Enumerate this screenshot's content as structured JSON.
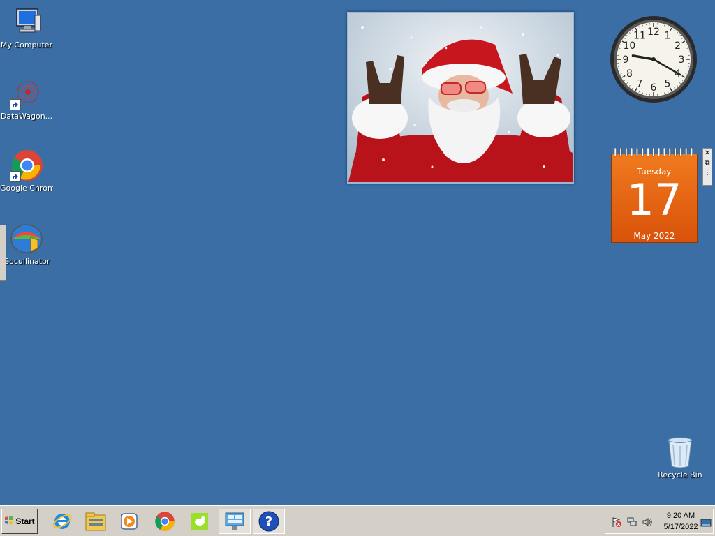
{
  "desktop": {
    "background_color": "#3a6ea5",
    "icons": [
      {
        "label": "My Computer",
        "icon": "computer-icon"
      },
      {
        "label": "DataWagon...",
        "icon": "datawagon-icon"
      },
      {
        "label": "Google Chrome",
        "icon": "chrome-icon"
      },
      {
        "label": "Gocullinator",
        "icon": "gocullinator-icon"
      },
      {
        "label": "Recycle Bin",
        "icon": "recycle-bin-icon"
      }
    ]
  },
  "gadgets": {
    "slideshow": {
      "subject": "santa-photo"
    },
    "clock": {
      "numerals": [
        "12",
        "1",
        "2",
        "3",
        "4",
        "5",
        "6",
        "7",
        "8",
        "9",
        "10",
        "11"
      ],
      "time": "9:20"
    },
    "calendar": {
      "weekday": "Tuesday",
      "day": "17",
      "month_year": "May 2022",
      "accent": "#e8650f"
    },
    "controls": {
      "close": "close-icon",
      "options": "options-icon",
      "drag": "drag-handle-icon"
    }
  },
  "taskbar": {
    "start_label": "Start",
    "pinned": [
      {
        "name": "internet-explorer-icon"
      },
      {
        "name": "file-explorer-icon"
      },
      {
        "name": "media-player-icon"
      },
      {
        "name": "chrome-icon"
      },
      {
        "name": "app-green-icon"
      },
      {
        "name": "control-panel-icon"
      },
      {
        "name": "help-icon"
      }
    ],
    "tray": {
      "time": "9:20 AM",
      "date": "5/17/2022",
      "icons": [
        "action-center-flag-icon",
        "network-icon",
        "volume-icon",
        "show-desktop-icon"
      ]
    }
  }
}
